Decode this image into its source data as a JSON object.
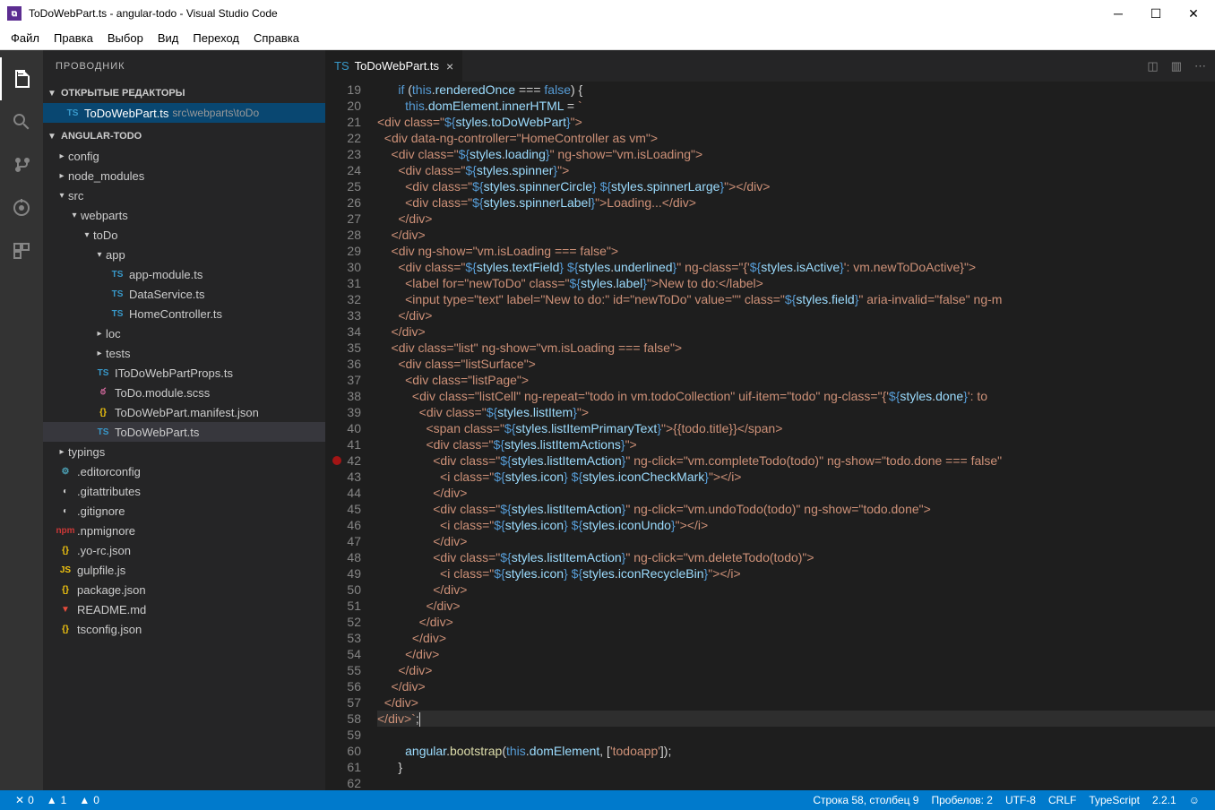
{
  "title": "ToDoWebPart.ts - angular-todo - Visual Studio Code",
  "menu": [
    "Файл",
    "Правка",
    "Выбор",
    "Вид",
    "Переход",
    "Справка"
  ],
  "sidebar_title": "ПРОВОДНИК",
  "open_editors_label": "ОТКРЫТЫЕ РЕДАКТОРЫ",
  "project_label": "ANGULAR-TODO",
  "open_editor": {
    "name": "ToDoWebPart.ts",
    "path": "src\\webparts\\toDo"
  },
  "tree": {
    "config": "config",
    "node_modules": "node_modules",
    "src": "src",
    "webparts": "webparts",
    "toDo": "toDo",
    "app": "app",
    "app_module": "app-module.ts",
    "DataService": "DataService.ts",
    "HomeController": "HomeController.ts",
    "loc": "loc",
    "tests": "tests",
    "IToDoWebPartProps": "IToDoWebPartProps.ts",
    "ToDo_module_scss": "ToDo.module.scss",
    "manifest": "ToDoWebPart.manifest.json",
    "ToDoWebPart": "ToDoWebPart.ts",
    "typings": "typings",
    "editorconfig": ".editorconfig",
    "gitattributes": ".gitattributes",
    "gitignore": ".gitignore",
    "npmignore": ".npmignore",
    "yorc": ".yo-rc.json",
    "gulpfile": "gulpfile.js",
    "package_json": "package.json",
    "readme": "README.md",
    "tsconfig": "tsconfig.json"
  },
  "tab": {
    "name": "ToDoWebPart.ts"
  },
  "breakpoint_line": 42,
  "lines_start": 19,
  "lines_end": 62,
  "status": {
    "errors": "0",
    "warnings": "1",
    "info": "0",
    "cursor": "Строка 58, столбец 9",
    "spaces": "Пробелов: 2",
    "encoding": "UTF-8",
    "eol": "CRLF",
    "lang": "TypeScript",
    "version": "2.2.1"
  }
}
